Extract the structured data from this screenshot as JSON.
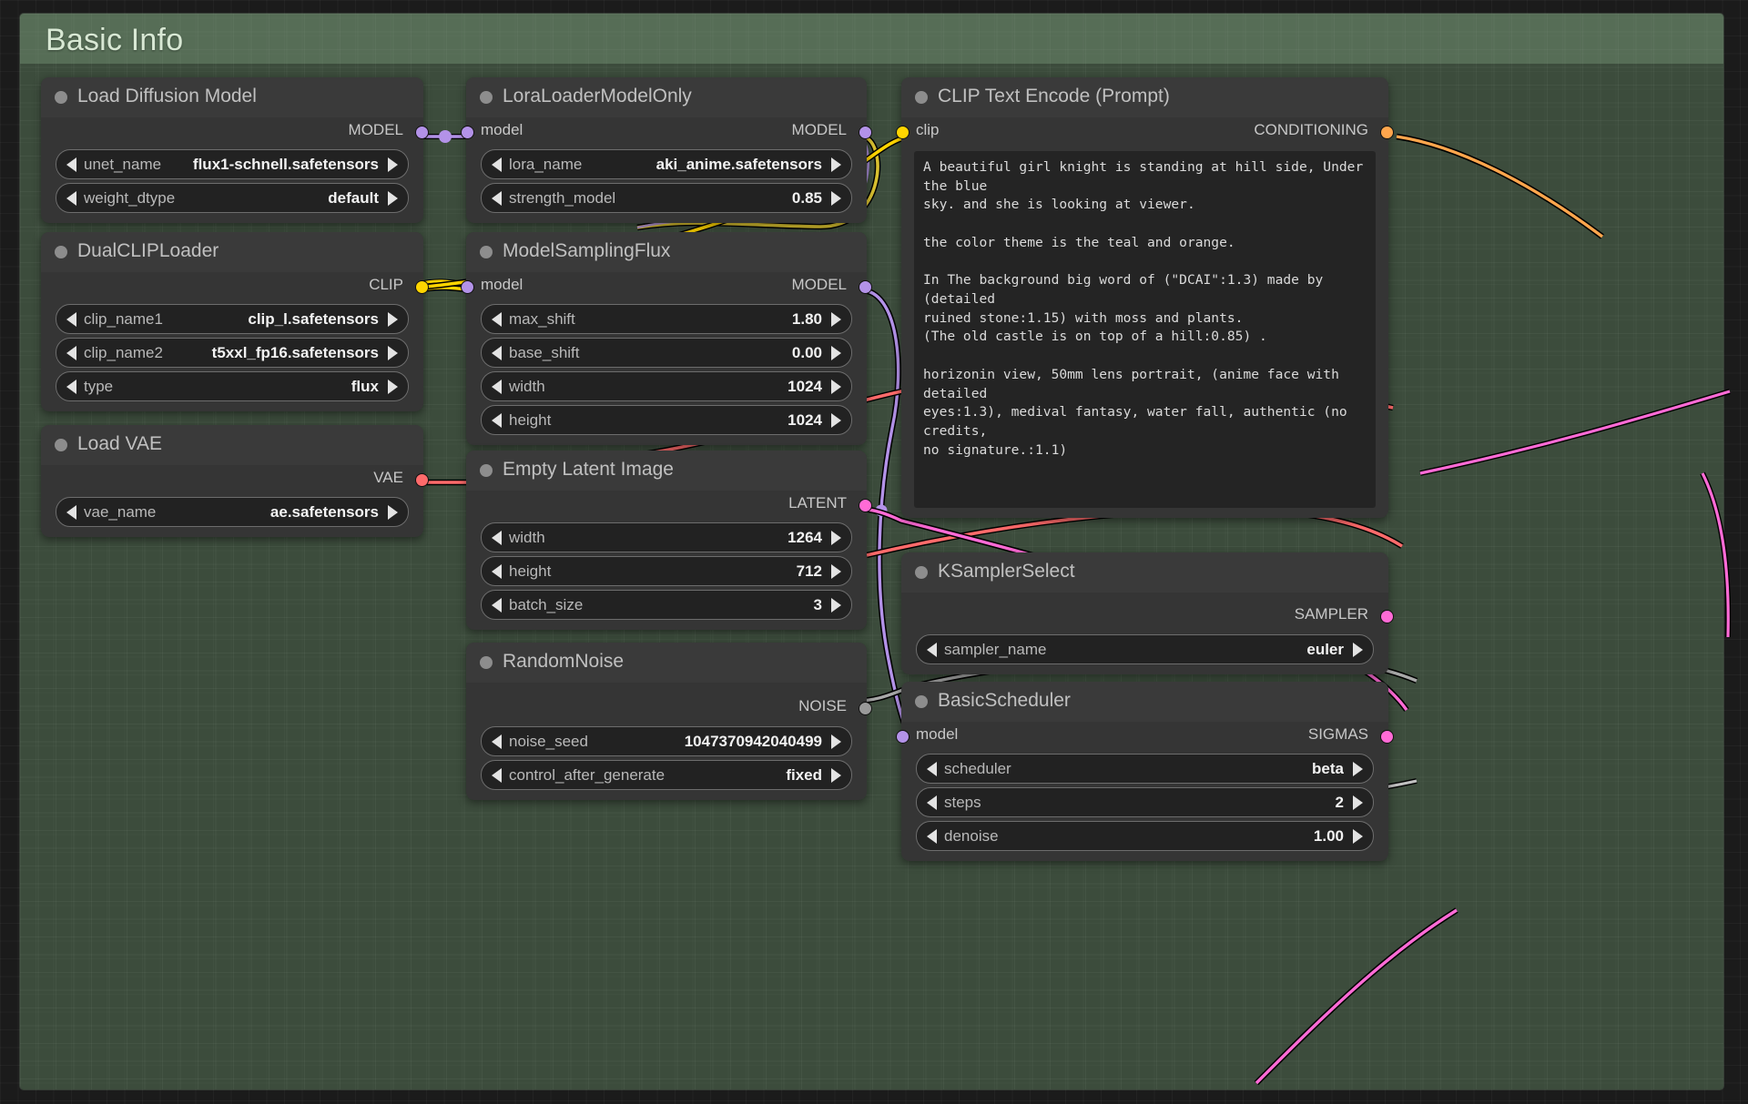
{
  "group": {
    "title": "Basic Info"
  },
  "nodes": {
    "load_diffusion_model": {
      "title": "Load Diffusion Model",
      "outputs": [
        {
          "label": "MODEL",
          "color": "#b392e8"
        }
      ],
      "widgets": [
        {
          "name": "unet_name",
          "value": "flux1-schnell.safetensors"
        },
        {
          "name": "weight_dtype",
          "value": "default"
        }
      ]
    },
    "dual_clip_loader": {
      "title": "DualCLIPLoader",
      "outputs": [
        {
          "label": "CLIP",
          "color": "#ffd500"
        }
      ],
      "widgets": [
        {
          "name": "clip_name1",
          "value": "clip_l.safetensors"
        },
        {
          "name": "clip_name2",
          "value": "t5xxl_fp16.safetensors"
        },
        {
          "name": "type",
          "value": "flux"
        }
      ]
    },
    "load_vae": {
      "title": "Load VAE",
      "outputs": [
        {
          "label": "VAE",
          "color": "#ff6b6b"
        }
      ],
      "widgets": [
        {
          "name": "vae_name",
          "value": "ae.safetensors"
        }
      ]
    },
    "lora_loader_model_only": {
      "title": "LoraLoaderModelOnly",
      "inputs": [
        {
          "label": "model",
          "color": "#b392e8"
        }
      ],
      "outputs": [
        {
          "label": "MODEL",
          "color": "#b392e8"
        }
      ],
      "widgets": [
        {
          "name": "lora_name",
          "value": "aki_anime.safetensors"
        },
        {
          "name": "strength_model",
          "value": "0.85"
        }
      ]
    },
    "model_sampling_flux": {
      "title": "ModelSamplingFlux",
      "inputs": [
        {
          "label": "model",
          "color": "#b392e8"
        }
      ],
      "outputs": [
        {
          "label": "MODEL",
          "color": "#b392e8"
        }
      ],
      "widgets": [
        {
          "name": "max_shift",
          "value": "1.80"
        },
        {
          "name": "base_shift",
          "value": "0.00"
        },
        {
          "name": "width",
          "value": "1024"
        },
        {
          "name": "height",
          "value": "1024"
        }
      ]
    },
    "empty_latent_image": {
      "title": "Empty Latent Image",
      "outputs": [
        {
          "label": "LATENT",
          "color": "#ff6bd6"
        }
      ],
      "widgets": [
        {
          "name": "width",
          "value": "1264"
        },
        {
          "name": "height",
          "value": "712"
        },
        {
          "name": "batch_size",
          "value": "3"
        }
      ]
    },
    "random_noise": {
      "title": "RandomNoise",
      "outputs": [
        {
          "label": "NOISE",
          "color": "#9a9a9a"
        }
      ],
      "widgets": [
        {
          "name": "noise_seed",
          "value": "1047370942040499"
        },
        {
          "name": "control_after_generate",
          "value": "fixed"
        }
      ]
    },
    "clip_text_encode": {
      "title": "CLIP Text Encode (Prompt)",
      "inputs": [
        {
          "label": "clip",
          "color": "#ffd500"
        }
      ],
      "outputs": [
        {
          "label": "CONDITIONING",
          "color": "#ffa64d"
        }
      ],
      "prompt": "A beautiful girl knight is standing at hill side, Under the blue\nsky. and she is looking at viewer.\n\nthe color theme is the teal and orange.\n\nIn The background big word of (\"DCAI\":1.3) made by (detailed\nruined stone:1.15) with moss and plants.\n(The old castle is on top of a hill:0.85) .\n\nhorizonin view, 50mm lens portrait, (anime face with detailed\neyes:1.3), medival fantasy, water fall, authentic (no credits,\nno signature.:1.1)"
    },
    "ksampler_select": {
      "title": "KSamplerSelect",
      "outputs": [
        {
          "label": "SAMPLER",
          "color": "#ff6bd6"
        }
      ],
      "widgets": [
        {
          "name": "sampler_name",
          "value": "euler"
        }
      ]
    },
    "basic_scheduler": {
      "title": "BasicScheduler",
      "inputs": [
        {
          "label": "model",
          "color": "#b392e8"
        }
      ],
      "outputs": [
        {
          "label": "SIGMAS",
          "color": "#ff6bd6"
        }
      ],
      "widgets": [
        {
          "name": "scheduler",
          "value": "beta"
        },
        {
          "name": "steps",
          "value": "2"
        },
        {
          "name": "denoise",
          "value": "1.00"
        }
      ]
    }
  },
  "colors": {
    "model": "#b392e8",
    "clip": "#ffd500",
    "vae": "#ff6b6b",
    "latent": "#ff6bd6",
    "noise": "#9a9a9a",
    "conditioning": "#ffa64d",
    "group_bg": "#5c7a5c",
    "node_bg": "#353535"
  }
}
